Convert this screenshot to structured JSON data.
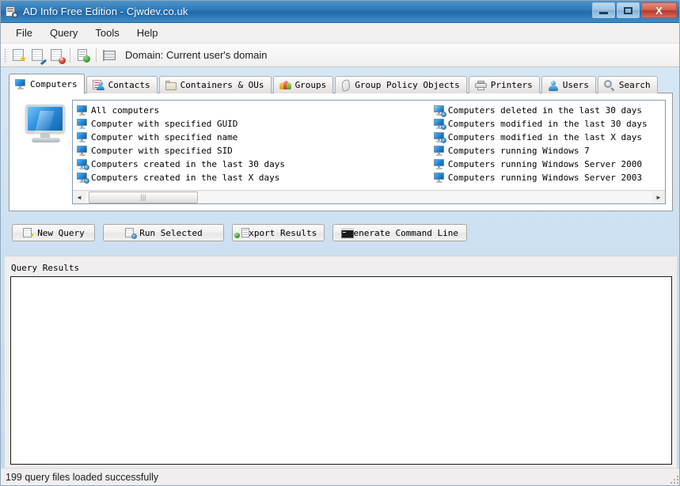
{
  "window": {
    "title": "AD Info Free Edition - Cjwdev.co.uk",
    "icon": "app-icon",
    "buttons": {
      "minimize": "minimize",
      "maximize": "maximize",
      "close": "X"
    }
  },
  "menubar": {
    "items": [
      {
        "label": "File"
      },
      {
        "label": "Query"
      },
      {
        "label": "Tools"
      },
      {
        "label": "Help"
      }
    ]
  },
  "toolbar": {
    "buttons": [
      {
        "name": "new-query-icon",
        "tooltip": "New Query"
      },
      {
        "name": "edit-query-icon",
        "tooltip": "Edit Query"
      },
      {
        "name": "delete-query-icon",
        "tooltip": "Delete Query"
      },
      {
        "name": "export-results-icon",
        "tooltip": "Export Results"
      },
      {
        "name": "select-domain-icon",
        "tooltip": "Select Domain"
      }
    ],
    "domain_label": "Domain: Current user's domain"
  },
  "tabs": [
    {
      "label": "Computers",
      "icon": "monitor-icon",
      "active": true
    },
    {
      "label": "Contacts",
      "icon": "contact-card-icon",
      "active": false
    },
    {
      "label": "Containers & OUs",
      "icon": "folder-icon",
      "active": false
    },
    {
      "label": "Groups",
      "icon": "groups-icon",
      "active": false
    },
    {
      "label": "Group Policy Objects",
      "icon": "scroll-icon",
      "active": false
    },
    {
      "label": "Printers",
      "icon": "printer-icon",
      "active": false
    },
    {
      "label": "Users",
      "icon": "user-icon",
      "active": false
    },
    {
      "label": "Search",
      "icon": "search-icon",
      "active": false
    }
  ],
  "panel": {
    "big_icon": "computer-monitor-graphic",
    "query_list": {
      "column1": [
        {
          "label": "All computers",
          "icon": "monitor-icon"
        },
        {
          "label": "Computer with specified GUID",
          "icon": "monitor-icon"
        },
        {
          "label": "Computer with specified name",
          "icon": "monitor-icon"
        },
        {
          "label": "Computer with specified SID",
          "icon": "monitor-icon"
        },
        {
          "label": "Computers created in the last 30 days",
          "icon": "monitor-badge-icon"
        },
        {
          "label": "Computers created in the last X days",
          "icon": "monitor-badge-icon"
        }
      ],
      "column2": [
        {
          "label": "Computers deleted in the last 30 days",
          "icon": "monitor-badge-icon"
        },
        {
          "label": "Computers modified in the last 30 days",
          "icon": "monitor-badge-icon"
        },
        {
          "label": "Computers modified in the last X days",
          "icon": "monitor-badge-icon"
        },
        {
          "label": "Computers running Windows 7",
          "icon": "monitor-icon"
        },
        {
          "label": "Computers running Windows Server 2000",
          "icon": "monitor-icon"
        },
        {
          "label": "Computers running Windows Server 2003",
          "icon": "monitor-icon"
        }
      ]
    },
    "scrollbar": {
      "left_arrow": "◄",
      "right_arrow": "►",
      "grip": "|||"
    }
  },
  "actions": [
    {
      "label": "New Query",
      "icon": "new-query-icon"
    },
    {
      "label": "Run Selected",
      "icon": "run-query-icon"
    },
    {
      "label": "Export Results",
      "icon": "export-icon"
    },
    {
      "label": "Generate Command Line",
      "icon": "command-line-icon"
    }
  ],
  "results": {
    "label": "Query Results",
    "content": ""
  },
  "statusbar": {
    "text": "199 query files loaded successfully"
  },
  "colors": {
    "titlebar_accent": "#2b78b8",
    "close_button": "#c0392b",
    "chrome_background": "#f0eeee",
    "panel_background": "#ffffff",
    "list_border": "#7f9db9"
  }
}
